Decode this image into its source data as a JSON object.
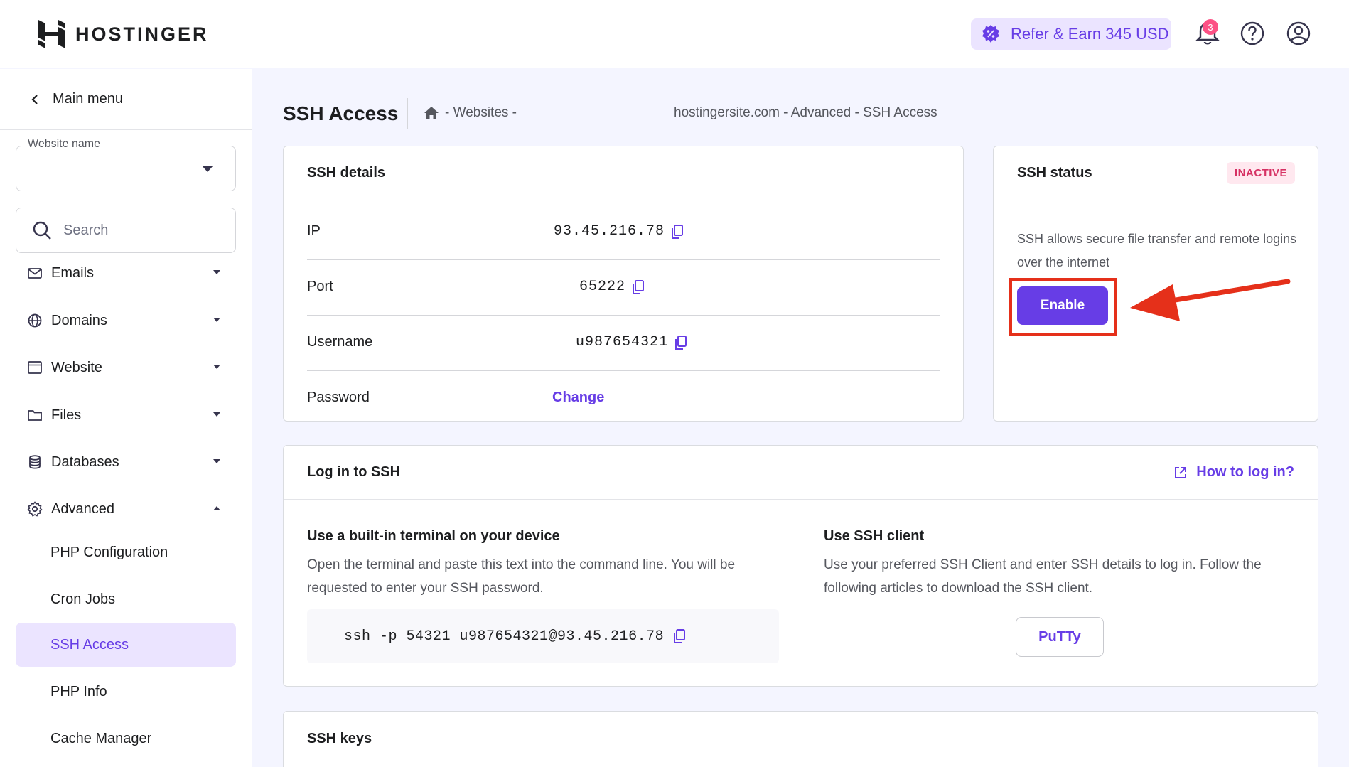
{
  "header": {
    "brand": "HOSTINGER",
    "refer_label": "Refer & Earn 345 USD",
    "notification_count": "3"
  },
  "sidebar": {
    "main_menu": "Main menu",
    "website_name_label": "Website name",
    "search_placeholder": "Search",
    "nav": [
      {
        "label": "Emails",
        "icon": "mail-icon"
      },
      {
        "label": "Domains",
        "icon": "globe-icon"
      },
      {
        "label": "Website",
        "icon": "browser-icon"
      },
      {
        "label": "Files",
        "icon": "folder-icon"
      },
      {
        "label": "Databases",
        "icon": "database-icon"
      },
      {
        "label": "Advanced",
        "icon": "gear-icon"
      }
    ],
    "advanced_items": [
      "PHP Configuration",
      "Cron Jobs",
      "SSH Access",
      "PHP Info",
      "Cache Manager"
    ],
    "active_item": "SSH Access"
  },
  "page": {
    "title": "SSH Access",
    "breadcrumb_mid": "- Websites -",
    "breadcrumb_tail": "hostingersite.com - Advanced - SSH Access"
  },
  "ssh_details": {
    "title": "SSH details",
    "rows": [
      {
        "label": "IP",
        "value": "93.45.216.78"
      },
      {
        "label": "Port",
        "value": "65222"
      },
      {
        "label": "Username",
        "value": "u987654321"
      },
      {
        "label": "Password",
        "value": "Change"
      }
    ]
  },
  "ssh_status": {
    "title": "SSH status",
    "badge": "INACTIVE",
    "description": "SSH allows secure file transfer and remote logins over the internet",
    "enable_label": "Enable"
  },
  "login": {
    "title": "Log in to SSH",
    "howto_label": "How to log in?",
    "terminal_title": "Use a built-in terminal on your device",
    "terminal_desc": "Open the terminal and paste this text into the command line. You will be requested to enter your SSH password.",
    "command": "ssh -p 54321 u987654321@93.45.216.78",
    "client_title": "Use SSH client",
    "client_desc": "Use your preferred SSH Client and enter SSH details to log in. Follow the following articles to download the SSH client.",
    "putty_label": "PuTTy"
  },
  "ssh_keys": {
    "title": "SSH keys"
  },
  "colors": {
    "accent": "#673de6",
    "accent_light": "#ebe4ff",
    "danger": "#e5301a",
    "badge_text": "#d63163"
  }
}
